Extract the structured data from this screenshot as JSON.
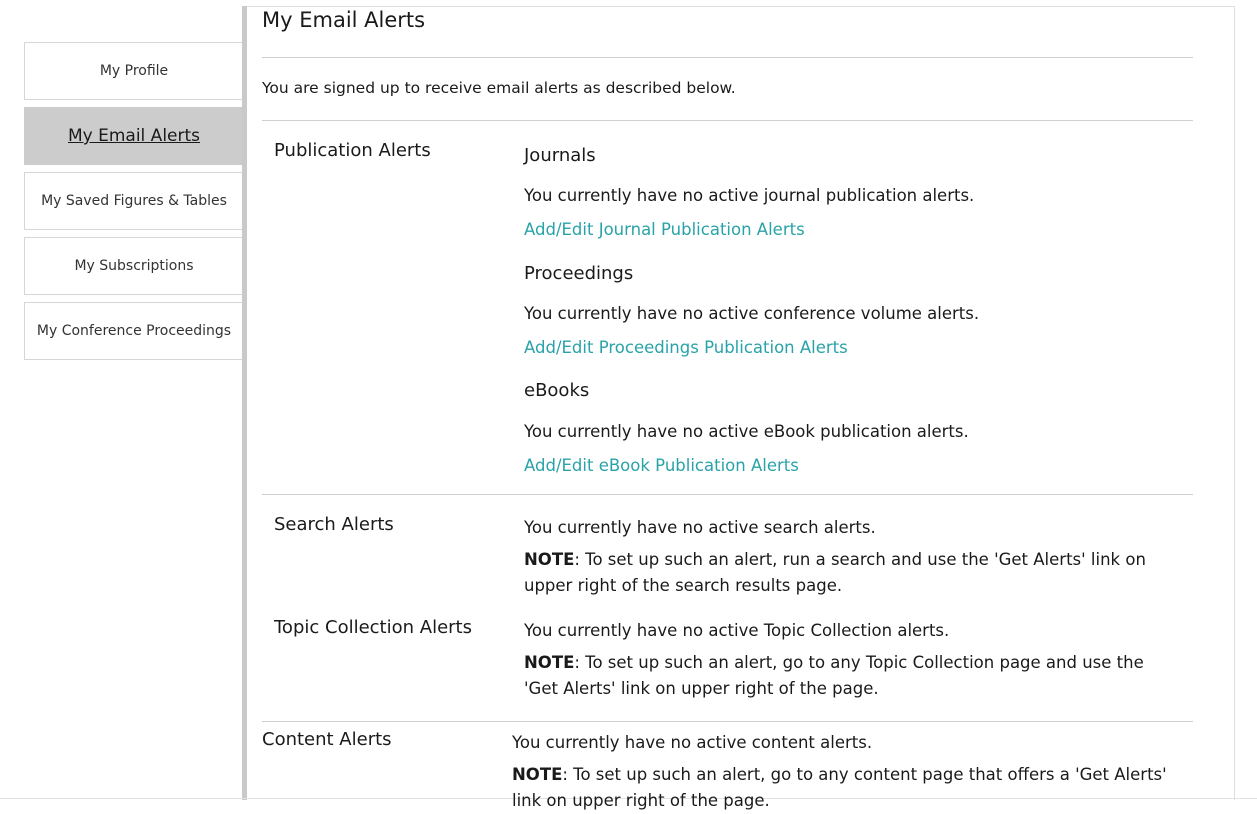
{
  "sidebar": {
    "items": [
      {
        "label": "My Profile"
      },
      {
        "label": "My Email Alerts"
      },
      {
        "label": "My Saved Figures & Tables"
      },
      {
        "label": "My Subscriptions"
      },
      {
        "label": "My Conference Proceedings"
      }
    ]
  },
  "main": {
    "title": "My Email Alerts",
    "intro": "You are signed up to receive email alerts as described below.",
    "publication": {
      "title": "Publication Alerts",
      "journals": {
        "heading": "Journals",
        "status": "You currently have no active journal publication alerts.",
        "link": "Add/Edit Journal Publication Alerts"
      },
      "proceedings": {
        "heading": "Proceedings",
        "status": "You currently have no active conference volume alerts.",
        "link": "Add/Edit Proceedings Publication Alerts"
      },
      "ebooks": {
        "heading": "eBooks",
        "status": "You currently have no active eBook publication alerts.",
        "link": "Add/Edit eBook Publication Alerts"
      }
    },
    "search": {
      "title": "Search Alerts",
      "status": "You currently have no active search alerts.",
      "note_label": "NOTE",
      "note_text": ": To set up such an alert, run a search and use the 'Get Alerts' link on upper right of the search results page."
    },
    "topic": {
      "title": "Topic Collection Alerts",
      "status": "You currently have no active Topic Collection alerts.",
      "note_label": "NOTE",
      "note_text": ": To set up such an alert, go to any Topic Collection page and use the 'Get Alerts' link on upper right of the page."
    },
    "content": {
      "title": "Content Alerts",
      "status": "You currently have no active content alerts.",
      "note_label": "NOTE",
      "note_text": ": To set up such an alert, go to any content page that offers a 'Get Alerts' link on upper right of the page."
    }
  }
}
